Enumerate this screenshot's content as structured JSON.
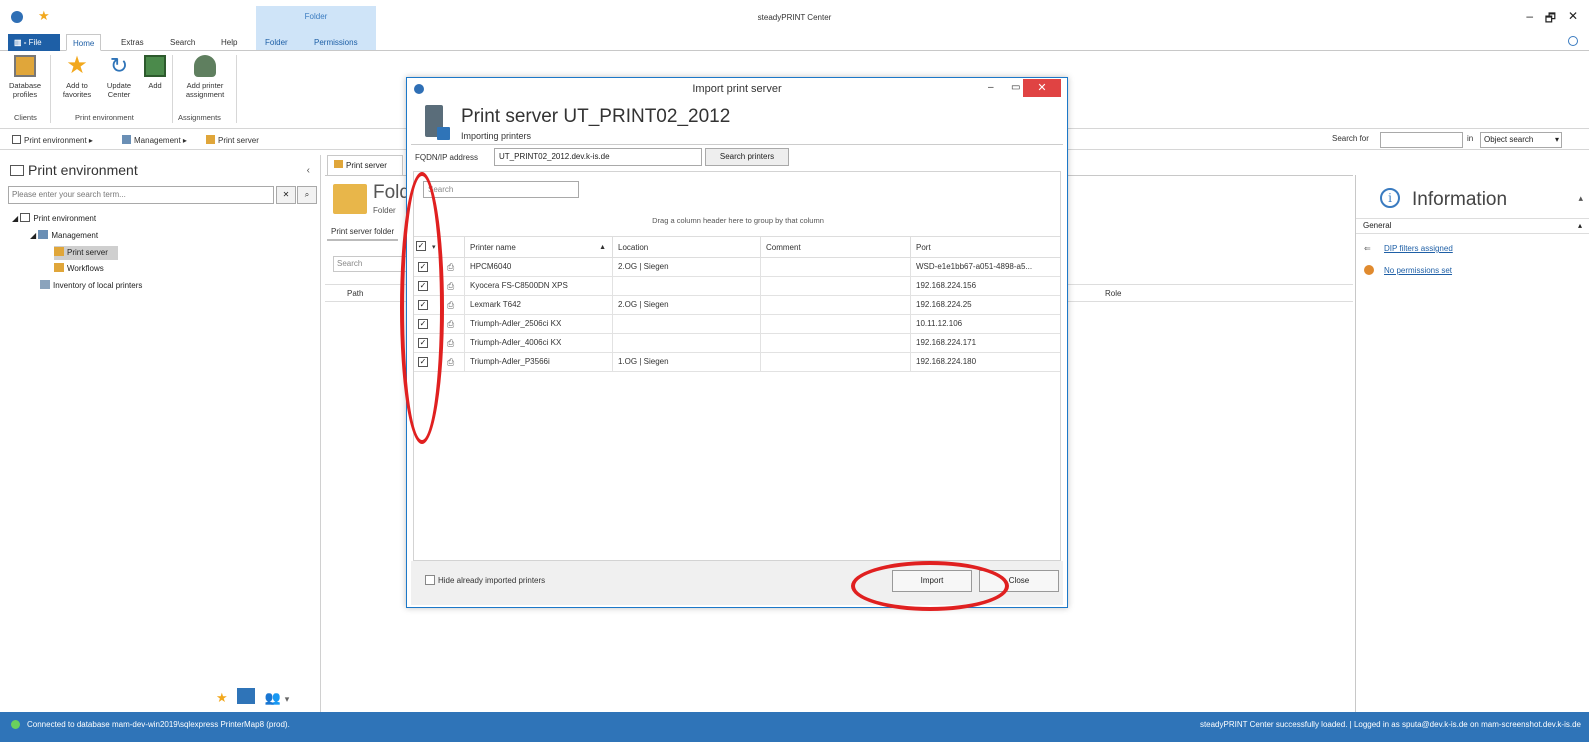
{
  "window": {
    "title": "steadyPRINT Center",
    "context_tab_group": "Folder"
  },
  "ribbon": {
    "tabs": [
      {
        "label": "File"
      },
      {
        "label": "Home"
      },
      {
        "label": "Extras"
      },
      {
        "label": "Search"
      },
      {
        "label": "Help"
      },
      {
        "label": "Folder"
      },
      {
        "label": "Permissions"
      }
    ],
    "buttons": [
      {
        "label": "Database profiles",
        "icon": "database-profiles-icon"
      },
      {
        "label": "Add to favorites",
        "icon": "star-icon"
      },
      {
        "label": "Update Center",
        "icon": "refresh-icon"
      },
      {
        "label": "Add",
        "icon": "add-icon"
      },
      {
        "label": "Add printer assignment",
        "icon": "printer-assignment-icon"
      }
    ],
    "groups": [
      "Clients",
      "Print environment",
      "Assignments"
    ]
  },
  "breadcrumb": [
    "Print environment",
    "Management",
    "Print server"
  ],
  "global_search": {
    "label": "Search for",
    "value": "",
    "in_label": "in",
    "scope": "Object search"
  },
  "left_panel": {
    "title": "Print environment",
    "search_placeholder": "Please enter your search term...",
    "tree": [
      {
        "label": "Print environment",
        "level": 0
      },
      {
        "label": "Management",
        "level": 1
      },
      {
        "label": "Print server",
        "level": 2,
        "selected": true
      },
      {
        "label": "Workflows",
        "level": 2
      },
      {
        "label": "Inventory of local printers",
        "level": 1
      }
    ]
  },
  "center": {
    "tab": "Print server",
    "title": "Folder",
    "subtitle": "Folder",
    "subtab": "Print server folder",
    "search_placeholder": "Search",
    "columns": [
      "Path",
      "Role"
    ]
  },
  "info_panel": {
    "title": "Information",
    "section": "General",
    "links": [
      "DIP filters assigned",
      "No permissions set"
    ]
  },
  "status": {
    "left": "Connected to database mam-dev-win2019\\sqlexpress PrinterMap8 (prod).",
    "right": "steadyPRINT Center successfully loaded. | Logged in as sputa@dev.k-is.de on mam-screenshot.dev.k-is.de"
  },
  "dialog": {
    "title": "Import print server",
    "heading": "Print server UT_PRINT02_2012",
    "subheading": "Importing printers",
    "fqdn_label": "FQDN/IP address",
    "fqdn_value": "UT_PRINT02_2012.dev.k-is.de",
    "search_button": "Search printers",
    "grid_search_placeholder": "Search",
    "group_hint": "Drag a column header here to group by that column",
    "columns": [
      "Printer name",
      "Location",
      "Comment",
      "Port"
    ],
    "rows": [
      {
        "name": "HPCM6040",
        "location": "2.OG | Siegen",
        "comment": "",
        "port": "WSD-e1e1bb67-a051-4898-a5...",
        "checked": true
      },
      {
        "name": "Kyocera FS-C8500DN XPS",
        "location": "",
        "comment": "",
        "port": "192.168.224.156",
        "checked": true
      },
      {
        "name": "Lexmark T642",
        "location": "2.OG | Siegen",
        "comment": "",
        "port": "192.168.224.25",
        "checked": true
      },
      {
        "name": "Triumph-Adler_2506ci KX",
        "location": "",
        "comment": "",
        "port": "10.11.12.106",
        "checked": true
      },
      {
        "name": "Triumph-Adler_4006ci KX",
        "location": "",
        "comment": "",
        "port": "192.168.224.171",
        "checked": true
      },
      {
        "name": "Triumph-Adler_P3566i",
        "location": "1.OG | Siegen",
        "comment": "",
        "port": "192.168.224.180",
        "checked": true
      }
    ],
    "hide_imported_label": "Hide already imported printers",
    "import_button": "Import",
    "close_button": "Close"
  },
  "colors": {
    "accent": "#2f74b8",
    "annotation": "#e02020",
    "close_red": "#e04343"
  }
}
